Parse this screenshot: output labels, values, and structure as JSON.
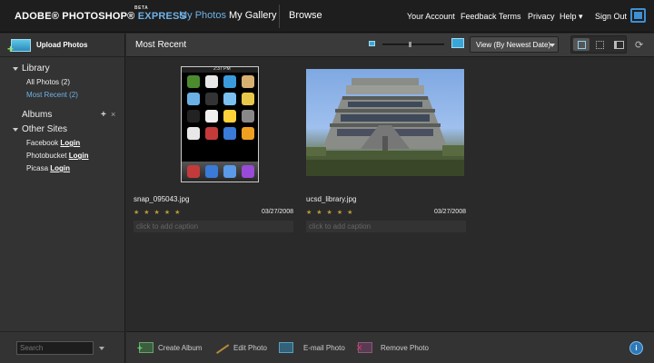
{
  "header": {
    "brand_main": "ADOBE® PHOTOSHOP®",
    "brand_express": "EXPRESS",
    "brand_beta": "BETA",
    "nav": {
      "my_photos": "My Photos",
      "my_gallery": "My Gallery",
      "browse": "Browse"
    },
    "links": {
      "account": "Your Account",
      "feedback": "Feedback",
      "terms": "Terms",
      "privacy": "Privacy",
      "help": "Help ▾",
      "sign_out": "Sign Out"
    }
  },
  "sidebar": {
    "upload": "Upload Photos",
    "library": {
      "title": "Library",
      "all_photos": "All Photos (2)",
      "most_recent": "Most Recent (2)"
    },
    "albums": {
      "title": "Albums",
      "add": "+",
      "remove": "×"
    },
    "other_sites": {
      "title": "Other Sites",
      "facebook": "Facebook",
      "facebook_link": "Login",
      "photobucket": "Photobucket",
      "photobucket_link": "Login",
      "picasa": "Picasa",
      "picasa_link": "Login"
    },
    "search_placeholder": "Search"
  },
  "toolbar": {
    "title": "Most Recent",
    "sort_label": "View (By Newest Date)",
    "zoom_level": 0.45
  },
  "photos": [
    {
      "name": "snap_095043.jpg",
      "date": "03/27/2008",
      "stars": "★★★★★",
      "caption_placeholder": "click to add caption"
    },
    {
      "name": "ucsd_library.jpg",
      "date": "03/27/2008",
      "stars": "★★★★★",
      "caption_placeholder": "click to add caption"
    }
  ],
  "bottombar": {
    "create_album": "Create Album",
    "edit_photo": "Edit Photo",
    "email_photo": "E-mail Photo",
    "remove_photo": "Remove Photo",
    "info": "i"
  },
  "iphone": {
    "status_time": "2:37 PM",
    "app_colors": [
      "#4c8a2e",
      "#e8e8e8",
      "#3a9bdc",
      "#d8b070",
      "#6ab0e6",
      "#333333",
      "#7ac0f0",
      "#e8c84a",
      "#222222",
      "#f0f0f0",
      "#ffd23a",
      "#888888",
      "#e8e8e8",
      "#c43a3a",
      "#3a7ad8",
      "#f0a020"
    ],
    "dock_colors": [
      "#c43a3a",
      "#3a7ad8",
      "#5a9ae8",
      "#9a4ad8"
    ]
  },
  "colors": {
    "accent": "#6fb2e6",
    "background": "#2a2a2a",
    "star": "#b89a3a"
  }
}
